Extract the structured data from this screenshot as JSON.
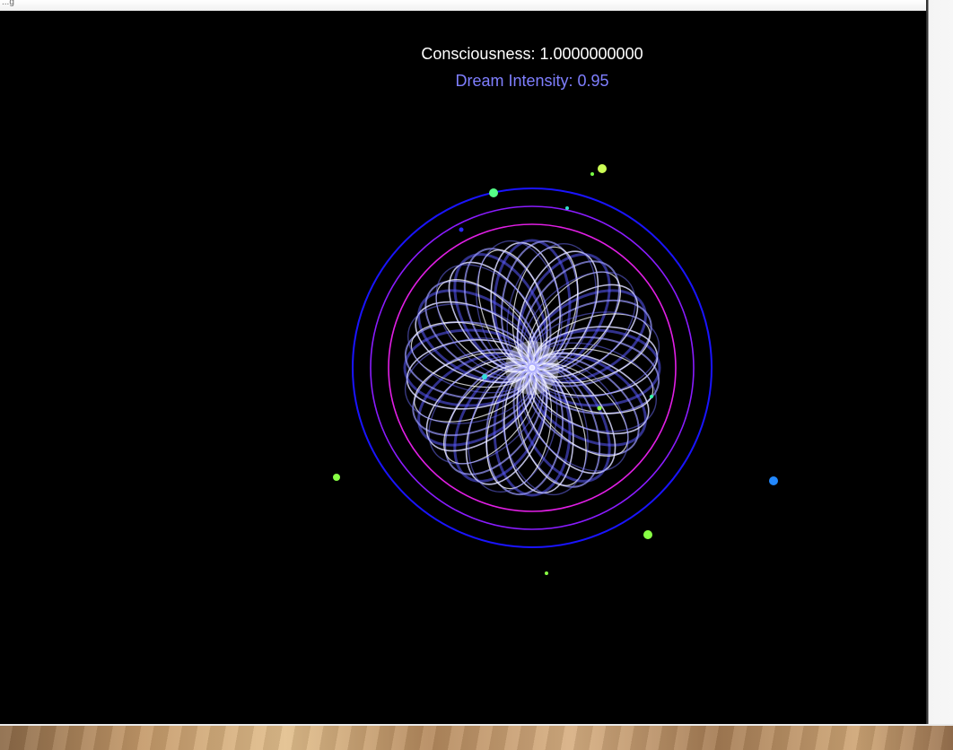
{
  "window": {
    "title_fragment": "...g"
  },
  "hud": {
    "consciousness_label": "Consciousness: 1.0000000000",
    "dream_intensity_label": "Dream Intensity: 0.95"
  },
  "colors": {
    "background": "#000000",
    "consciousness_text": "#ffffff",
    "dream_text": "#7f7fff",
    "outer_ring": "#1a14ff",
    "middle_ring": "#8a1cff",
    "inner_ring": "#e21fe6",
    "flower_stroke": "#b8b8ff",
    "flower_core": "#ffffff"
  },
  "scene": {
    "rings": [
      {
        "name": "outer-ring",
        "color": "#1a14ff"
      },
      {
        "name": "middle-ring",
        "color": "#8a1cff"
      },
      {
        "name": "inner-ring",
        "color": "#e21fe6"
      }
    ],
    "particles": [
      {
        "name": "particle-1",
        "color": "#ccff55"
      },
      {
        "name": "particle-2",
        "color": "#77ff44"
      },
      {
        "name": "particle-3",
        "color": "#55ff88"
      },
      {
        "name": "particle-4",
        "color": "#33ddcc"
      },
      {
        "name": "particle-5",
        "color": "#2b2bff"
      },
      {
        "name": "particle-6",
        "color": "#88ff44"
      },
      {
        "name": "particle-7",
        "color": "#2288ff"
      },
      {
        "name": "particle-8",
        "color": "#88ff44"
      },
      {
        "name": "particle-9",
        "color": "#88ff44"
      },
      {
        "name": "particle-10",
        "color": "#33dddd"
      },
      {
        "name": "particle-11",
        "color": "#88ff44"
      },
      {
        "name": "particle-12",
        "color": "#33ffaa"
      }
    ]
  }
}
